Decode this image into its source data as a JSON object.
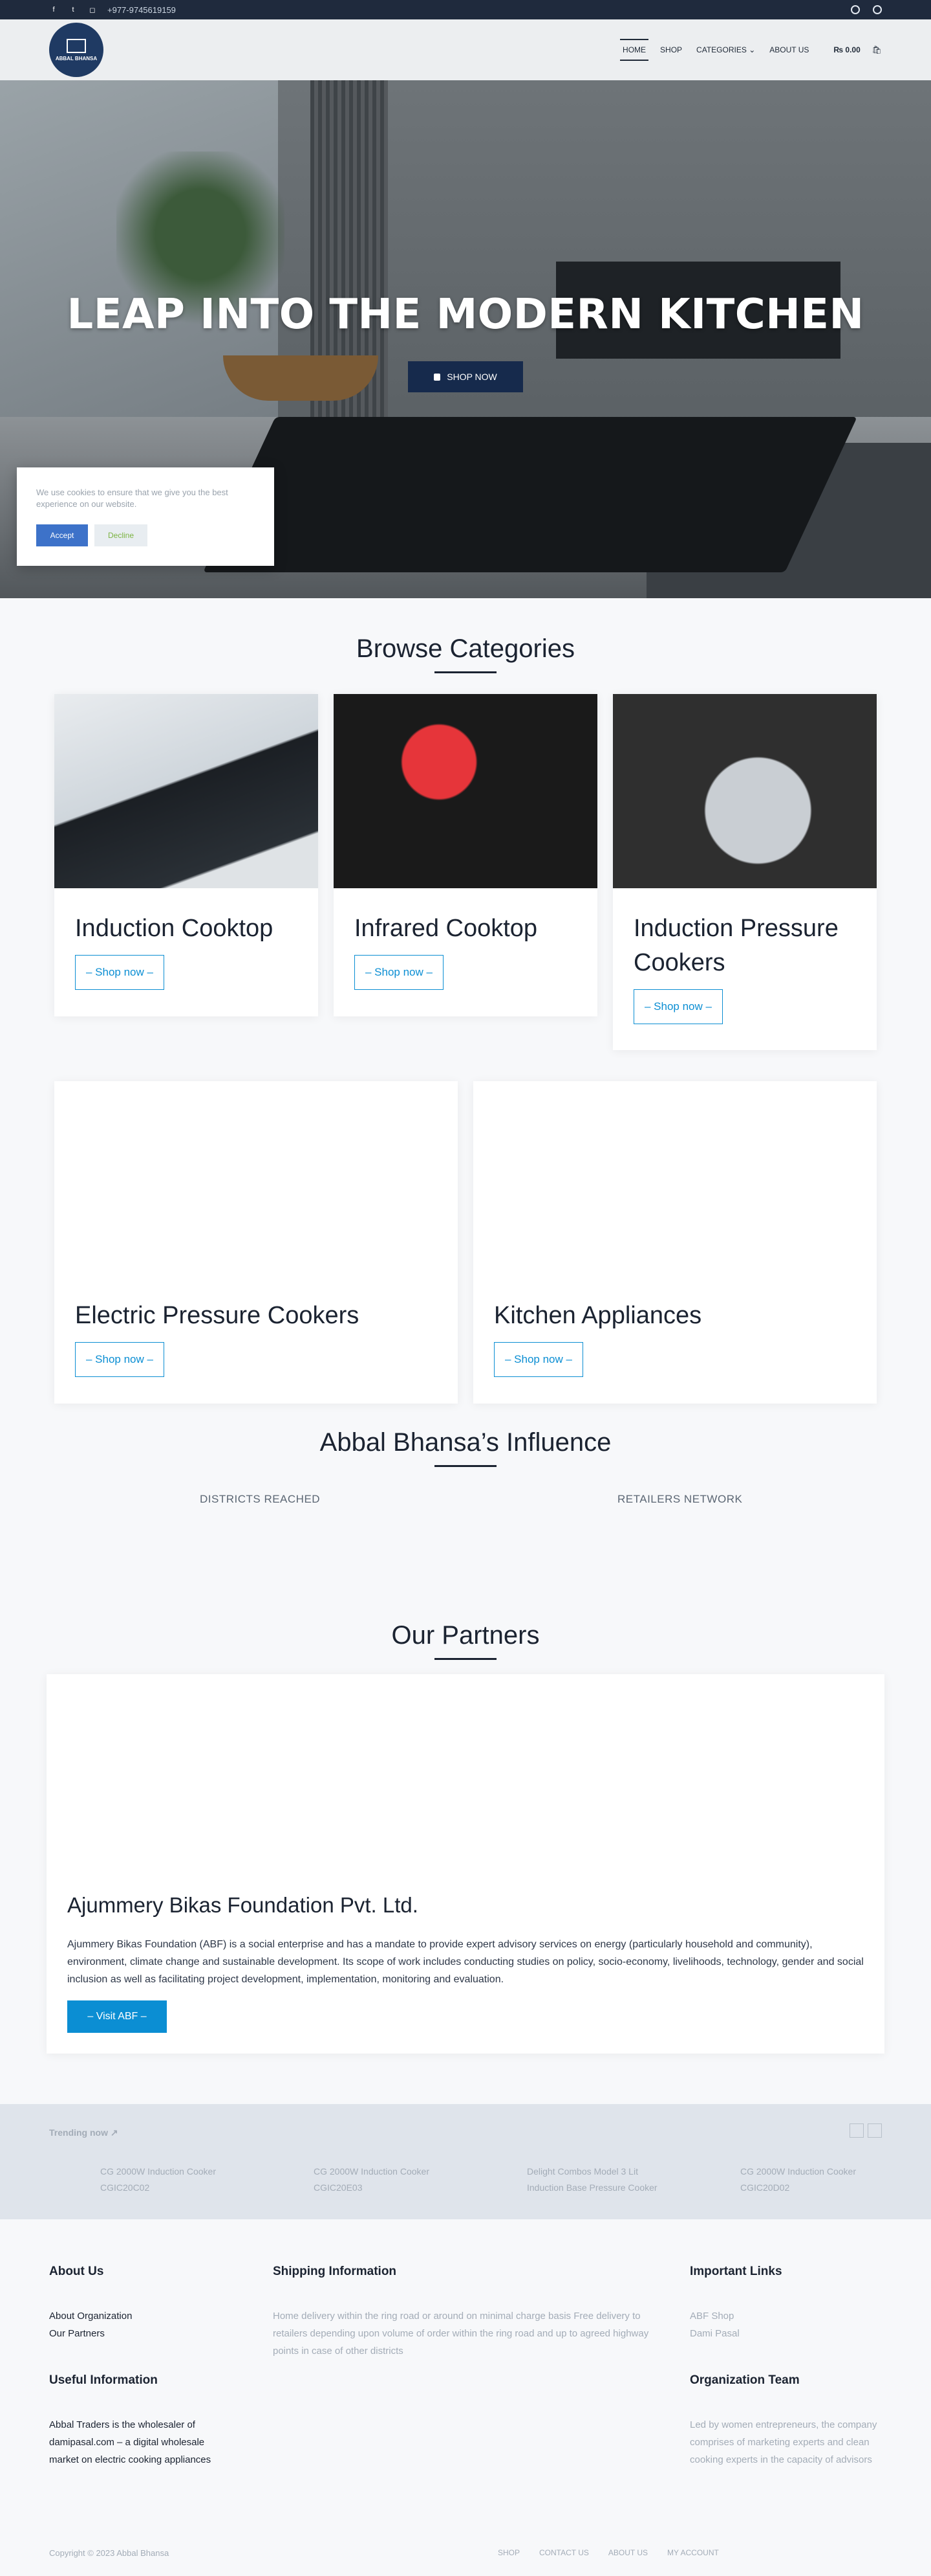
{
  "topbar": {
    "phone": "+977-9745619159",
    "social_icons": [
      "facebook-icon",
      "twitter-icon",
      "instagram-icon"
    ]
  },
  "header": {
    "logo_text": "ABBAL BHANSA",
    "nav": [
      "HOME",
      "SHOP",
      "CATEGORIES",
      "ABOUT US"
    ],
    "cart_total": "₨ 0.00"
  },
  "hero": {
    "title": "LEAP INTO THE MODERN KITCHEN",
    "button": "SHOP NOW"
  },
  "cookie": {
    "text": "We use cookies to ensure that we give you the best experience on our website.",
    "accept": "Accept",
    "decline": "Decline"
  },
  "browse": {
    "title": "Browse Categories",
    "categories": [
      {
        "name": "Induction Cooktop",
        "cta": "– Shop now –"
      },
      {
        "name": "Infrared Cooktop",
        "cta": "– Shop now –"
      },
      {
        "name": "Induction Pressure Cookers",
        "cta": "– Shop now –"
      },
      {
        "name": "Electric Pressure Cookers",
        "cta": "– Shop now –"
      },
      {
        "name": "Kitchen Appliances",
        "cta": "– Shop now –"
      }
    ]
  },
  "influence": {
    "title": "Abbal Bhansa’s Influence",
    "stats": [
      "DISTRICTS REACHED",
      "RETAILERS NETWORK"
    ]
  },
  "partners": {
    "title": "Our Partners",
    "name": "Ajummery Bikas Foundation Pvt. Ltd.",
    "description": "Ajummery Bikas Foundation (ABF) is a social enterprise and has a mandate to provide expert advisory services on energy (particularly household and community), environment, climate change and sustainable development. Its scope of work includes conducting studies on policy, socio-economy, livelihoods, technology, gender and social inclusion as well as facilitating project development, implementation, monitoring and evaluation.",
    "button": "– Visit ABF –"
  },
  "trending": {
    "label": "Trending now",
    "items": [
      {
        "line1": "CG 2000W Induction Cooker",
        "line2": "CGIC20C02"
      },
      {
        "line1": "CG 2000W Induction Cooker",
        "line2": "CGIC20E03"
      },
      {
        "line1": "Delight Combos Model 3 Lit",
        "line2": "Induction Base Pressure Cooker"
      },
      {
        "line1": "CG 2000W Induction Cooker",
        "line2": "CGIC20D02"
      }
    ]
  },
  "footer": {
    "about_title": "About Us",
    "about_links": [
      "About Organization",
      "Our Partners"
    ],
    "useful_title": "Useful Information",
    "useful_text": "Abbal Traders is the wholesaler of damipasal.com – a digital wholesale market on electric cooking appliances",
    "shipping_title": "Shipping Information",
    "shipping_text": "Home delivery within the ring road or around on minimal charge basis Free delivery to retailers depending upon volume of order within the ring road and up to agreed highway points in case of other districts",
    "links_title": "Important Links",
    "links": [
      "ABF Shop",
      "Dami Pasal"
    ],
    "team_title": "Organization Team",
    "team_text": "Led by women entrepreneurs, the company comprises of marketing experts and clean cooking experts in the capacity of advisors",
    "copyright": "Copyright © 2023 Abbal Bhansa",
    "bottom_links": [
      "SHOP",
      "CONTACT US",
      "ABOUT US",
      "MY ACCOUNT"
    ]
  }
}
